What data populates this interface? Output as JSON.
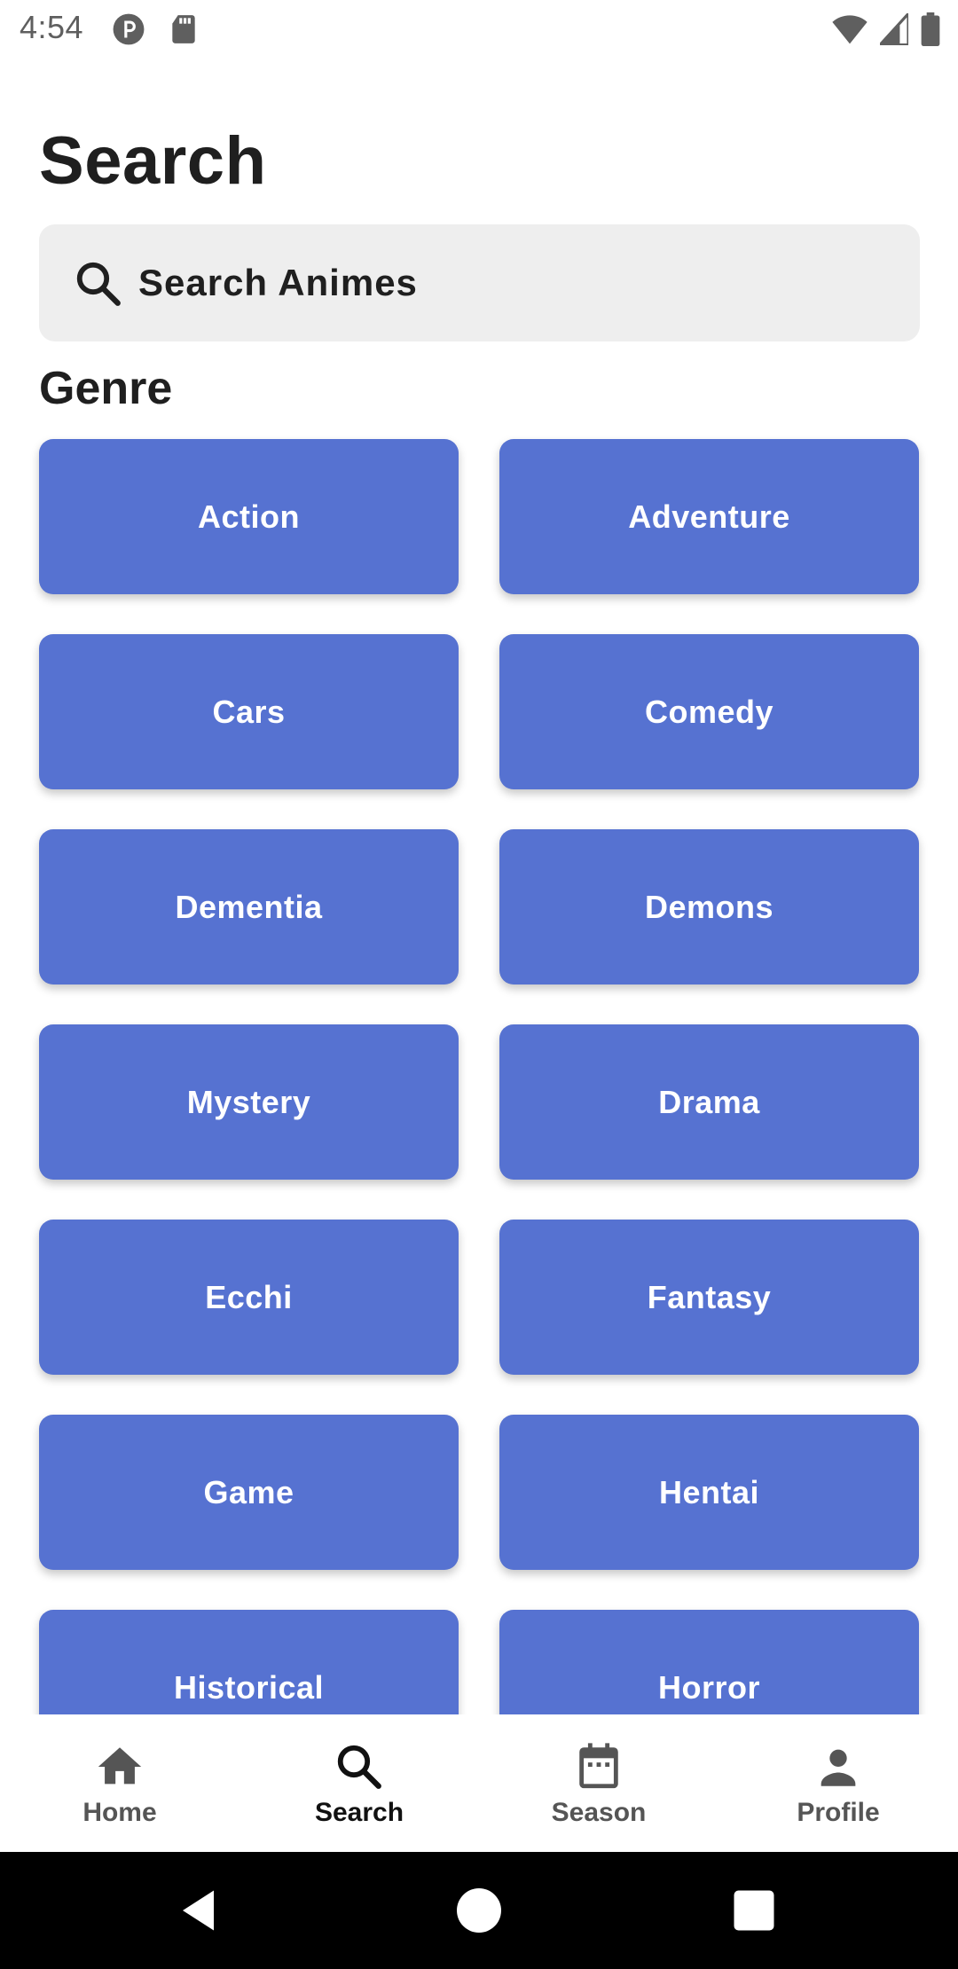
{
  "status_bar": {
    "time": "4:54"
  },
  "header": {
    "title": "Search"
  },
  "search": {
    "placeholder": "Search Animes",
    "value": ""
  },
  "genre_section": {
    "title": "Genre",
    "items": [
      {
        "label": "Action"
      },
      {
        "label": "Adventure"
      },
      {
        "label": "Cars"
      },
      {
        "label": "Comedy"
      },
      {
        "label": "Dementia"
      },
      {
        "label": "Demons"
      },
      {
        "label": "Mystery"
      },
      {
        "label": "Drama"
      },
      {
        "label": "Ecchi"
      },
      {
        "label": "Fantasy"
      },
      {
        "label": "Game"
      },
      {
        "label": "Hentai"
      },
      {
        "label": "Historical"
      },
      {
        "label": "Horror"
      }
    ]
  },
  "bottom_nav": {
    "items": [
      {
        "label": "Home",
        "icon": "home-icon",
        "active": false
      },
      {
        "label": "Search",
        "icon": "search-icon",
        "active": true
      },
      {
        "label": "Season",
        "icon": "calendar-icon",
        "active": false
      },
      {
        "label": "Profile",
        "icon": "person-icon",
        "active": false
      }
    ]
  },
  "colors": {
    "accent": "#5672d1",
    "search_bg": "#eeeeee",
    "text_primary": "#1f1f1f",
    "nav_inactive": "#555555"
  }
}
